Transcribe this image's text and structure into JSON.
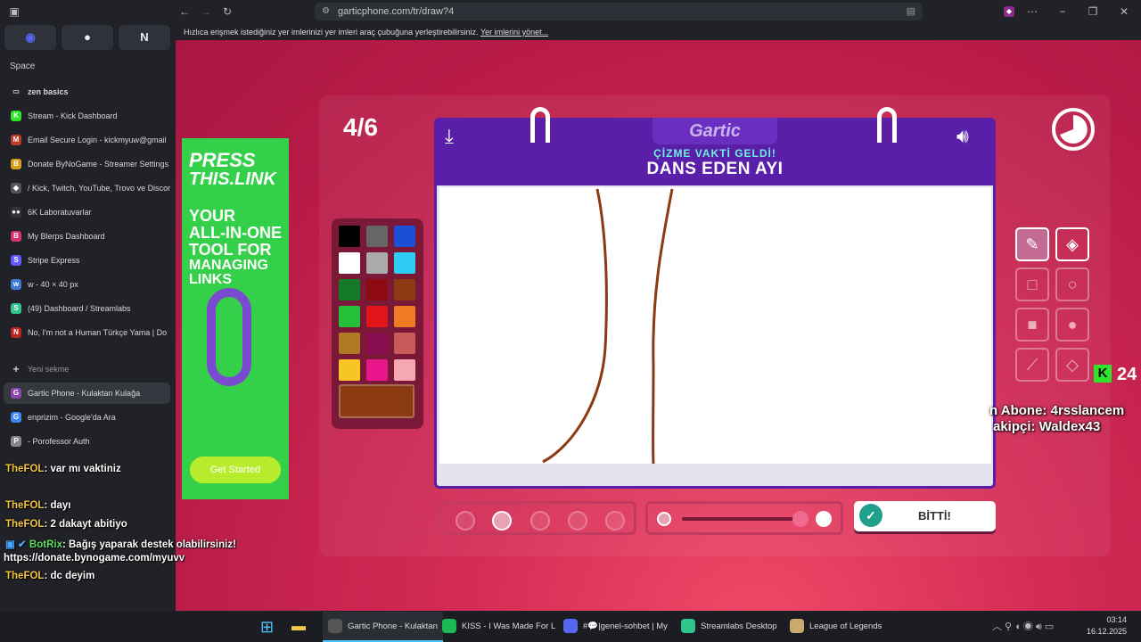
{
  "browser": {
    "url": "garticphone.com/tr/draw?4",
    "bookmark_hint": "Hızlıca erişmek istediğiniz yer imlerinizi yer imleri araç çubuğuna yerleştirebilirsiniz.",
    "bookmark_link": "Yer imlerini yönet...",
    "window_controls": [
      "−",
      "❐",
      "✕"
    ]
  },
  "sidebar": {
    "space_label": "Space",
    "folder_label": "zen basics",
    "tabs": [
      {
        "label": "Stream - Kick Dashboard",
        "color": "#2ee52a",
        "glyph": "K"
      },
      {
        "label": "Email Secure Login - kickmyuw@gmail",
        "color": "#c0392b",
        "glyph": "M"
      },
      {
        "label": "Donate ByNoGame - Streamer Settings",
        "color": "#d4a017",
        "glyph": "B"
      },
      {
        "label": "/ Kick, Twitch, YouTube, Trovo ve Discor",
        "color": "#555",
        "glyph": "◆"
      },
      {
        "label": "6K Laboratuvarlar",
        "color": "#333",
        "glyph": "●●"
      },
      {
        "label": "My Blerps Dashboard",
        "color": "#d6336c",
        "glyph": "B"
      },
      {
        "label": "Stripe Express",
        "color": "#635bff",
        "glyph": "S"
      },
      {
        "label": "w - 40 × 40 px",
        "color": "#3a7bd5",
        "glyph": "w"
      },
      {
        "label": "(49) Dashboard / Streamlabs",
        "color": "#31c48d",
        "glyph": "S"
      },
      {
        "label": "No, I'm not a Human Türkçe Yama | Do",
        "color": "#b22",
        "glyph": "N"
      }
    ],
    "new_tab_label": "Yeni sekme",
    "open_tabs": [
      {
        "label": "Gartic Phone - Kulaktan Kulağa",
        "color": "#8e44ad",
        "glyph": "G"
      },
      {
        "label": "enprizim - Google'da Ara",
        "color": "#4285f4",
        "glyph": "G"
      },
      {
        "label": "- Porofessor Auth",
        "color": "#888",
        "glyph": "P"
      }
    ]
  },
  "chat": [
    {
      "user": "TheFOL",
      "text": ": var mı vaktiniz"
    },
    {
      "user": "TheFOL",
      "text": ": dayı"
    },
    {
      "user": "TheFOL",
      "text": ": 2 dakayt abitiyo"
    },
    {
      "user": "BotRix",
      "text": ": Bağış yaparak destek olabilirsiniz!"
    },
    {
      "user": "",
      "text": "https://donate.bynogame.com/myuvv"
    },
    {
      "user": "TheFOL",
      "text": ": dc deyim"
    }
  ],
  "game": {
    "round": "4/6",
    "logo": "Gartic",
    "subtitle": "ÇİZME VAKTİ GELDİ!",
    "prompt": "DANS EDEN AYI",
    "palette": [
      "#000000",
      "#666666",
      "#1a4fd6",
      "#ffffff",
      "#aaaaaa",
      "#2ecbf2",
      "#157a28",
      "#8c0a10",
      "#8b3a12",
      "#26c13a",
      "#e3151a",
      "#f07a24",
      "#b07a24",
      "#8a0f50",
      "#c95a5a",
      "#f7c624",
      "#e8148a",
      "#f5a8b2"
    ],
    "selected_color": "#8b3a12",
    "done_label": "BİTTİ!",
    "ad": {
      "line1": "PRESS",
      "line2": "THIS.LINK",
      "line3": "YOUR",
      "line4": "ALL-IN-ONE",
      "line5": "TOOL FOR",
      "line6": "MANAGING LINKS",
      "button": "Get Started"
    }
  },
  "overlay": {
    "kick_count": "24",
    "sub_label": "n Abone: 4rsslancem",
    "follow_label": "akipçi: Waldex43"
  },
  "taskbar": {
    "items": [
      {
        "label": "Gartic Phone - Kulaktan",
        "color": "#555"
      },
      {
        "label": "KISS - I Was Made For L",
        "color": "#1db954"
      },
      {
        "label": "#💬|genel-sohbet | My",
        "color": "#5865f2"
      },
      {
        "label": "Streamlabs Desktop",
        "color": "#31c48d"
      },
      {
        "label": "League of Legends",
        "color": "#c8aa6e"
      }
    ],
    "time": "03:14",
    "date": "16.12.2025"
  }
}
